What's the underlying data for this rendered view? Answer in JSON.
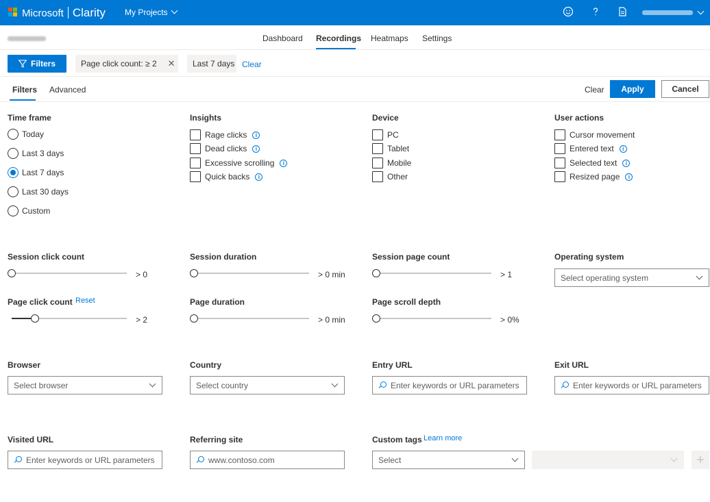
{
  "header": {
    "brand_ms": "Microsoft",
    "brand_product": "Clarity",
    "projects_label": "My Projects",
    "logo_colors": [
      "#f25022",
      "#7fba00",
      "#00a4ef",
      "#ffb900"
    ]
  },
  "nav": {
    "tabs": [
      "Dashboard",
      "Recordings",
      "Heatmaps",
      "Settings"
    ],
    "active": "Recordings"
  },
  "chips": {
    "filters_label": "Filters",
    "page_click": "Page click count: ≥ 2",
    "timeframe": "Last 7 days",
    "clear": "Clear"
  },
  "subtabs": {
    "filters": "Filters",
    "advanced": "Advanced",
    "clear": "Clear",
    "apply": "Apply",
    "cancel": "Cancel"
  },
  "timeframe": {
    "title": "Time frame",
    "options": [
      "Today",
      "Last 3 days",
      "Last 7 days",
      "Last 30 days",
      "Custom"
    ],
    "selected": "Last 7 days"
  },
  "insights": {
    "title": "Insights",
    "items": [
      "Rage clicks",
      "Dead clicks",
      "Excessive scrolling",
      "Quick backs"
    ]
  },
  "device": {
    "title": "Device",
    "items": [
      "PC",
      "Tablet",
      "Mobile",
      "Other"
    ]
  },
  "user_actions": {
    "title": "User actions",
    "items": [
      "Cursor movement",
      "Entered text",
      "Selected text",
      "Resized page"
    ]
  },
  "sliders": {
    "session_click": {
      "title": "Session click count",
      "value": "> 0",
      "level": 0
    },
    "session_duration": {
      "title": "Session duration",
      "value": "> 0 min",
      "level": 0
    },
    "session_page": {
      "title": "Session page count",
      "value": "> 1",
      "level": 0
    },
    "page_click": {
      "title": "Page click count",
      "value": "> 2",
      "level": 0.2,
      "reset": "Reset"
    },
    "page_duration": {
      "title": "Page duration",
      "value": "> 0 min",
      "level": 0
    },
    "page_scroll": {
      "title": "Page scroll depth",
      "value": "> 0%",
      "level": 0
    }
  },
  "os": {
    "title": "Operating system",
    "placeholder": "Select operating system"
  },
  "browser": {
    "title": "Browser",
    "placeholder": "Select browser"
  },
  "country": {
    "title": "Country",
    "placeholder": "Select country"
  },
  "entry_url": {
    "title": "Entry URL",
    "placeholder": "Enter keywords or URL parameters"
  },
  "exit_url": {
    "title": "Exit URL",
    "placeholder": "Enter keywords or URL parameters"
  },
  "visited_url": {
    "title": "Visited URL",
    "placeholder": "Enter keywords or URL parameters"
  },
  "referring": {
    "title": "Referring site",
    "placeholder": "www.contoso.com"
  },
  "custom_tags": {
    "title": "Custom tags",
    "learn_more": "Learn more",
    "placeholder": "Select"
  }
}
